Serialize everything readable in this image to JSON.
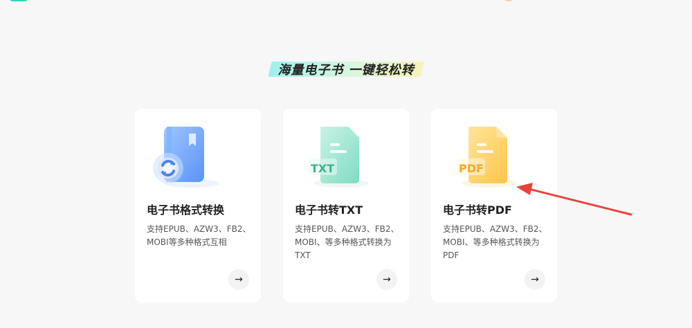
{
  "header": {
    "headline": "海量电子书 一键轻松转"
  },
  "cards": [
    {
      "title": "电子书格式转换",
      "description": "支持EPUB、AZW3、FB2、MOBI等多种格式互相",
      "icon": "ebook-convert-icon",
      "arrow": "→"
    },
    {
      "title": "电子书转TXT",
      "description": "支持EPUB、AZW3、FB2、MOBI、等多种格式转换为TXT",
      "icon": "txt-file-icon",
      "icon_label": "TXT",
      "arrow": "→"
    },
    {
      "title": "电子书转PDF",
      "description": "支持EPUB、AZW3、FB2、MOBI、等多种格式转换为PDF",
      "icon": "pdf-file-icon",
      "icon_label": "PDF",
      "arrow": "→"
    }
  ],
  "colors": {
    "accent_red": "#e8433b",
    "card_blue": "#6aa7ff",
    "card_green": "#7ddcc3",
    "card_yellow": "#ffd25a"
  }
}
